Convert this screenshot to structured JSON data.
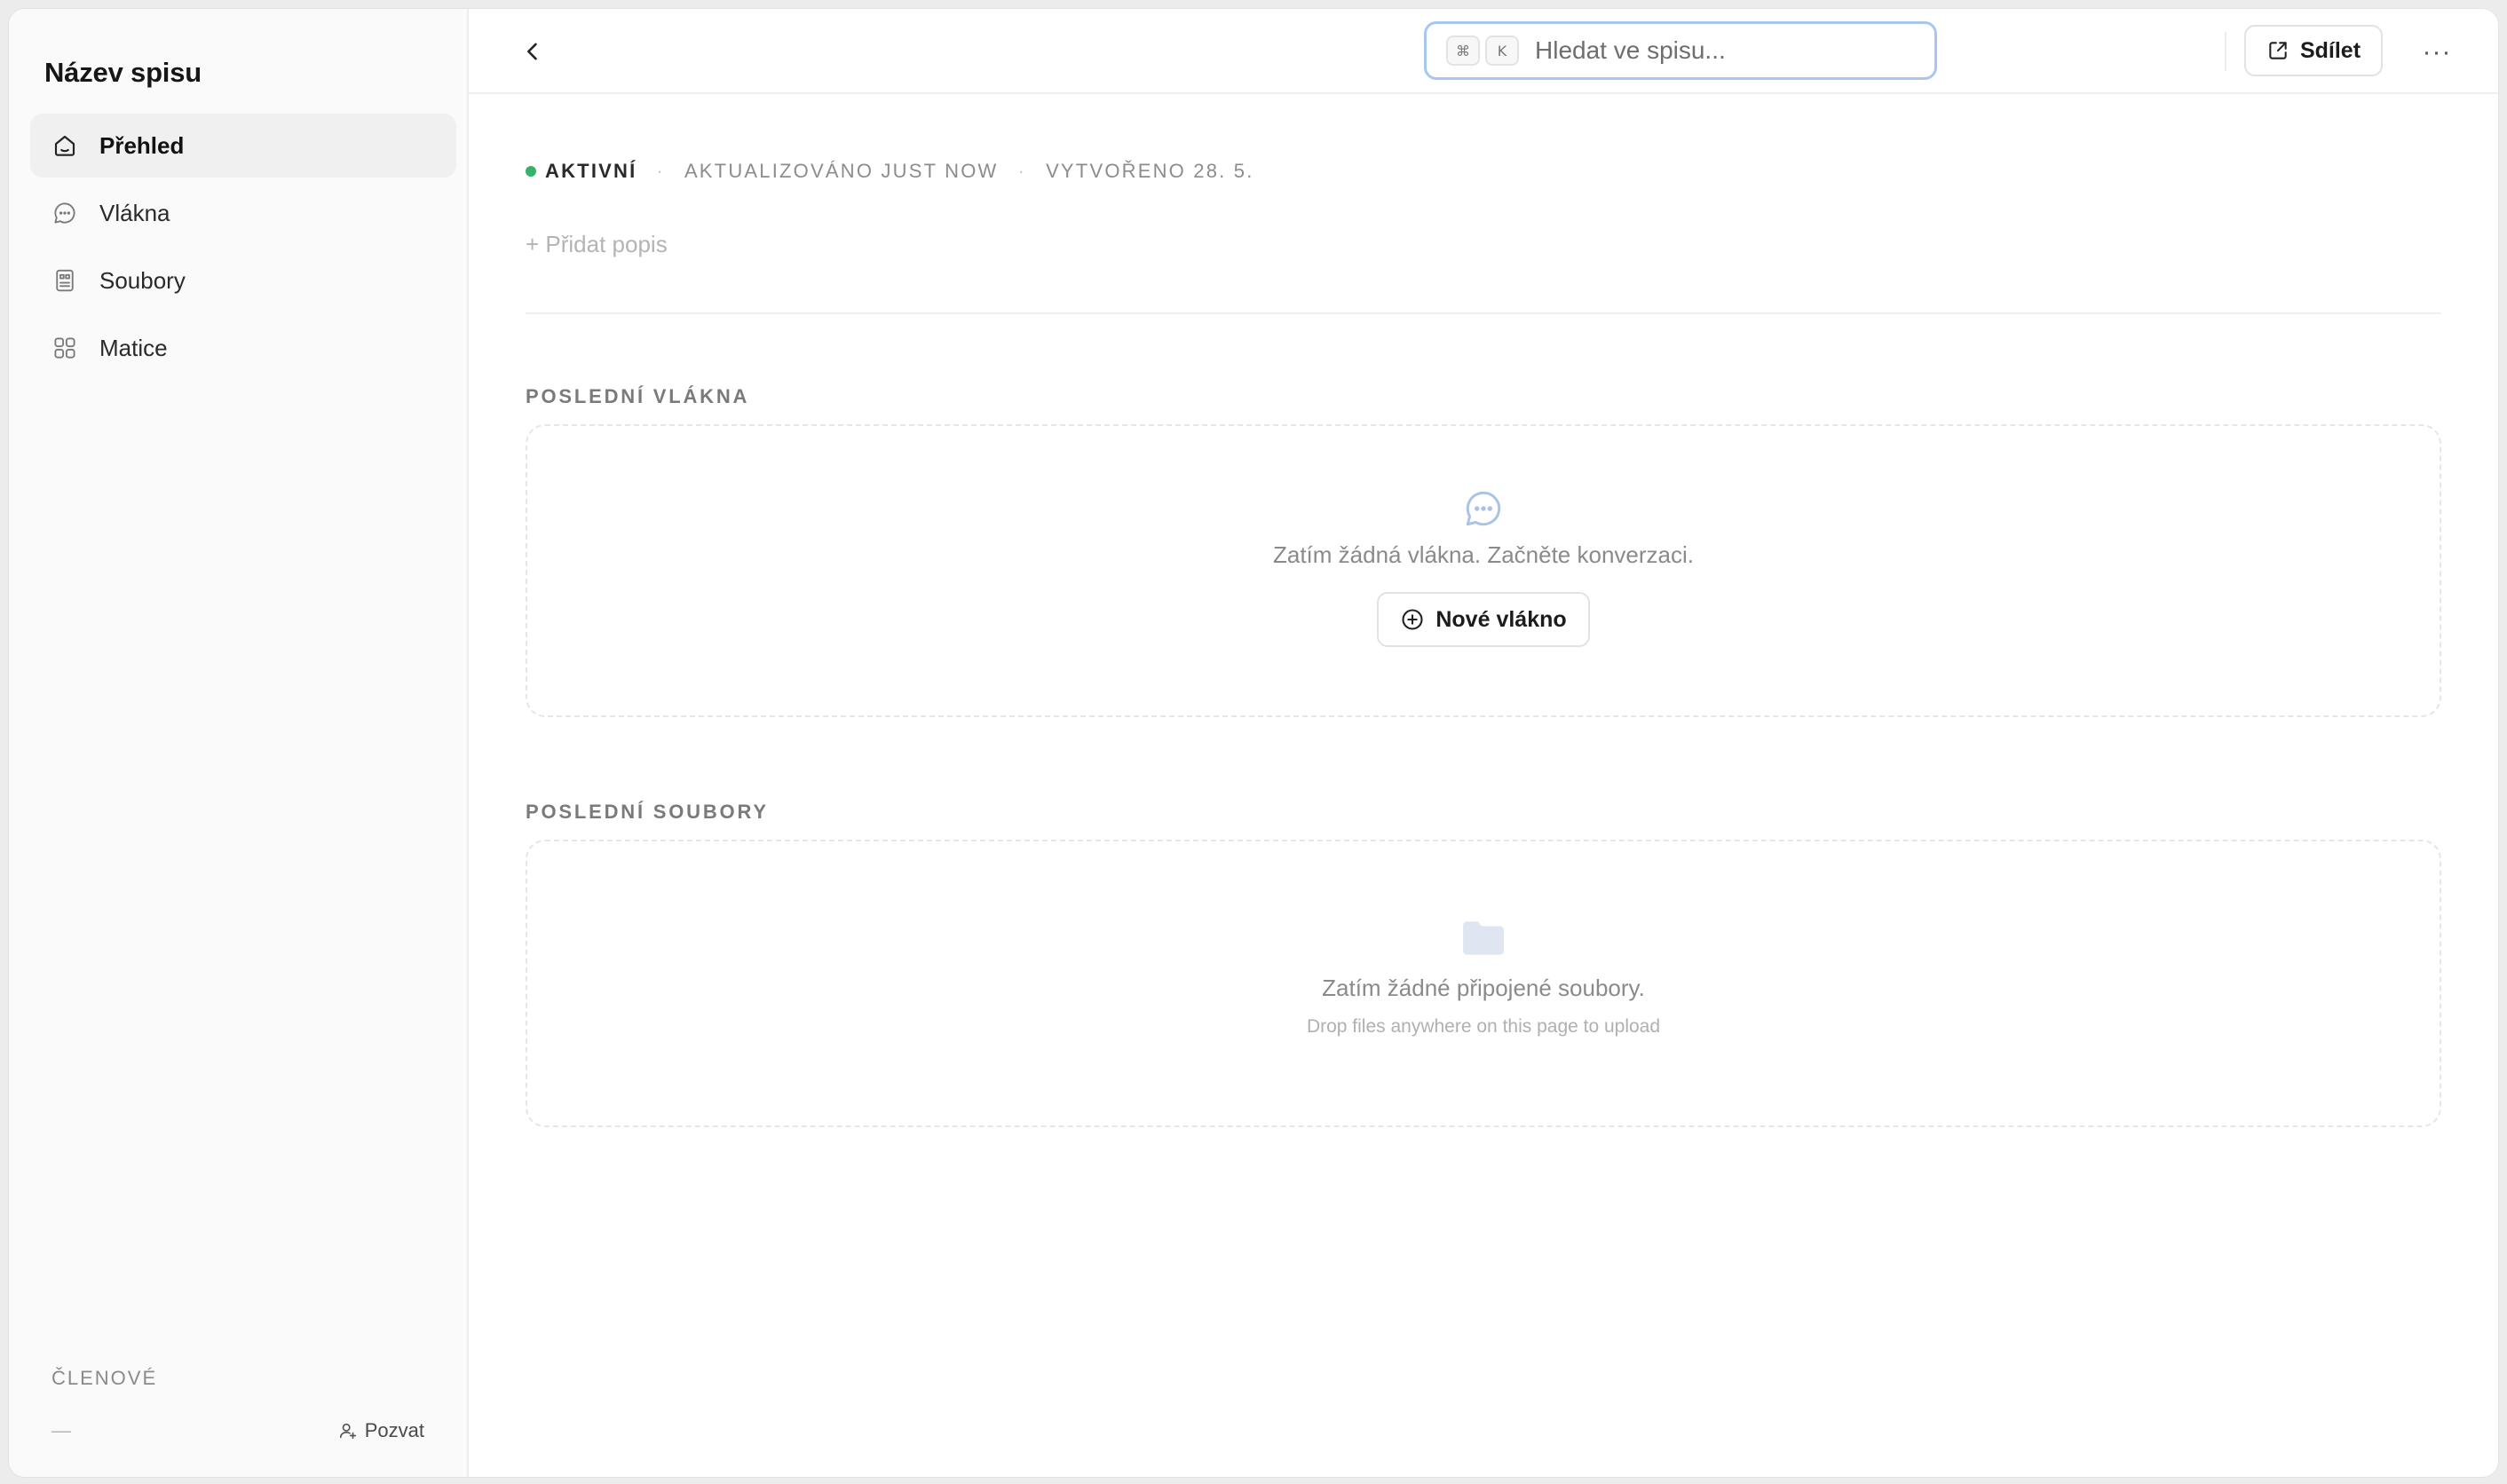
{
  "sidebar": {
    "title": "Název spisu",
    "items": [
      {
        "label": "Přehled",
        "icon": "home-icon",
        "active": true
      },
      {
        "label": "Vlákna",
        "icon": "chat-bubble-icon",
        "active": false
      },
      {
        "label": "Soubory",
        "icon": "file-icon",
        "active": false
      },
      {
        "label": "Matice",
        "icon": "grid-icon",
        "active": false
      }
    ],
    "members_label": "ČLENOVÉ",
    "members_empty": "—",
    "invite_label": "Pozvat"
  },
  "topbar": {
    "search_placeholder": "Hledat ve spisu...",
    "kbd_cmd": "⌘",
    "kbd_k": "K",
    "share_label": "Sdílet",
    "more_label": "···"
  },
  "meta": {
    "status": "AKTIVNÍ",
    "separator": "·",
    "updated": "AKTUALIZOVÁNO JUST NOW",
    "created": "VYTVOŘENO 28. 5."
  },
  "add_description": "+ Přidat popis",
  "threads": {
    "section_label": "POSLEDNÍ VLÁKNA",
    "empty_text": "Zatím žádná vlákna. Začněte konverzaci.",
    "new_button": "Nové vlákno"
  },
  "files": {
    "section_label": "POSLEDNÍ SOUBORY",
    "empty_text": "Zatím žádné připojené soubory.",
    "hint": "Drop files anywhere on this page to upload"
  },
  "colors": {
    "status_active": "#35b36a",
    "search_focus_border": "#a9c6ef",
    "empty_icon": "#a9c2e6"
  }
}
